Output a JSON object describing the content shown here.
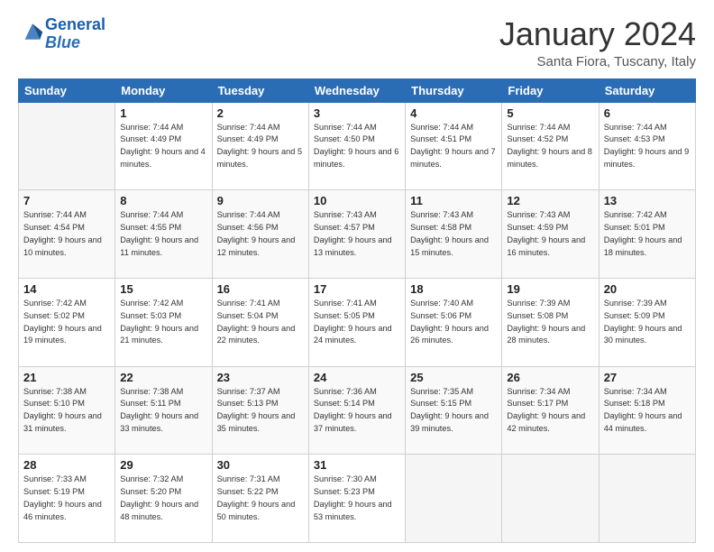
{
  "header": {
    "logo_general": "General",
    "logo_blue": "Blue",
    "month": "January 2024",
    "location": "Santa Fiora, Tuscany, Italy"
  },
  "weekdays": [
    "Sunday",
    "Monday",
    "Tuesday",
    "Wednesday",
    "Thursday",
    "Friday",
    "Saturday"
  ],
  "weeks": [
    [
      {
        "day": "",
        "sunrise": "",
        "sunset": "",
        "daylight": ""
      },
      {
        "day": "1",
        "sunrise": "Sunrise: 7:44 AM",
        "sunset": "Sunset: 4:49 PM",
        "daylight": "Daylight: 9 hours and 4 minutes."
      },
      {
        "day": "2",
        "sunrise": "Sunrise: 7:44 AM",
        "sunset": "Sunset: 4:49 PM",
        "daylight": "Daylight: 9 hours and 5 minutes."
      },
      {
        "day": "3",
        "sunrise": "Sunrise: 7:44 AM",
        "sunset": "Sunset: 4:50 PM",
        "daylight": "Daylight: 9 hours and 6 minutes."
      },
      {
        "day": "4",
        "sunrise": "Sunrise: 7:44 AM",
        "sunset": "Sunset: 4:51 PM",
        "daylight": "Daylight: 9 hours and 7 minutes."
      },
      {
        "day": "5",
        "sunrise": "Sunrise: 7:44 AM",
        "sunset": "Sunset: 4:52 PM",
        "daylight": "Daylight: 9 hours and 8 minutes."
      },
      {
        "day": "6",
        "sunrise": "Sunrise: 7:44 AM",
        "sunset": "Sunset: 4:53 PM",
        "daylight": "Daylight: 9 hours and 9 minutes."
      }
    ],
    [
      {
        "day": "7",
        "sunrise": "Sunrise: 7:44 AM",
        "sunset": "Sunset: 4:54 PM",
        "daylight": "Daylight: 9 hours and 10 minutes."
      },
      {
        "day": "8",
        "sunrise": "Sunrise: 7:44 AM",
        "sunset": "Sunset: 4:55 PM",
        "daylight": "Daylight: 9 hours and 11 minutes."
      },
      {
        "day": "9",
        "sunrise": "Sunrise: 7:44 AM",
        "sunset": "Sunset: 4:56 PM",
        "daylight": "Daylight: 9 hours and 12 minutes."
      },
      {
        "day": "10",
        "sunrise": "Sunrise: 7:43 AM",
        "sunset": "Sunset: 4:57 PM",
        "daylight": "Daylight: 9 hours and 13 minutes."
      },
      {
        "day": "11",
        "sunrise": "Sunrise: 7:43 AM",
        "sunset": "Sunset: 4:58 PM",
        "daylight": "Daylight: 9 hours and 15 minutes."
      },
      {
        "day": "12",
        "sunrise": "Sunrise: 7:43 AM",
        "sunset": "Sunset: 4:59 PM",
        "daylight": "Daylight: 9 hours and 16 minutes."
      },
      {
        "day": "13",
        "sunrise": "Sunrise: 7:42 AM",
        "sunset": "Sunset: 5:01 PM",
        "daylight": "Daylight: 9 hours and 18 minutes."
      }
    ],
    [
      {
        "day": "14",
        "sunrise": "Sunrise: 7:42 AM",
        "sunset": "Sunset: 5:02 PM",
        "daylight": "Daylight: 9 hours and 19 minutes."
      },
      {
        "day": "15",
        "sunrise": "Sunrise: 7:42 AM",
        "sunset": "Sunset: 5:03 PM",
        "daylight": "Daylight: 9 hours and 21 minutes."
      },
      {
        "day": "16",
        "sunrise": "Sunrise: 7:41 AM",
        "sunset": "Sunset: 5:04 PM",
        "daylight": "Daylight: 9 hours and 22 minutes."
      },
      {
        "day": "17",
        "sunrise": "Sunrise: 7:41 AM",
        "sunset": "Sunset: 5:05 PM",
        "daylight": "Daylight: 9 hours and 24 minutes."
      },
      {
        "day": "18",
        "sunrise": "Sunrise: 7:40 AM",
        "sunset": "Sunset: 5:06 PM",
        "daylight": "Daylight: 9 hours and 26 minutes."
      },
      {
        "day": "19",
        "sunrise": "Sunrise: 7:39 AM",
        "sunset": "Sunset: 5:08 PM",
        "daylight": "Daylight: 9 hours and 28 minutes."
      },
      {
        "day": "20",
        "sunrise": "Sunrise: 7:39 AM",
        "sunset": "Sunset: 5:09 PM",
        "daylight": "Daylight: 9 hours and 30 minutes."
      }
    ],
    [
      {
        "day": "21",
        "sunrise": "Sunrise: 7:38 AM",
        "sunset": "Sunset: 5:10 PM",
        "daylight": "Daylight: 9 hours and 31 minutes."
      },
      {
        "day": "22",
        "sunrise": "Sunrise: 7:38 AM",
        "sunset": "Sunset: 5:11 PM",
        "daylight": "Daylight: 9 hours and 33 minutes."
      },
      {
        "day": "23",
        "sunrise": "Sunrise: 7:37 AM",
        "sunset": "Sunset: 5:13 PM",
        "daylight": "Daylight: 9 hours and 35 minutes."
      },
      {
        "day": "24",
        "sunrise": "Sunrise: 7:36 AM",
        "sunset": "Sunset: 5:14 PM",
        "daylight": "Daylight: 9 hours and 37 minutes."
      },
      {
        "day": "25",
        "sunrise": "Sunrise: 7:35 AM",
        "sunset": "Sunset: 5:15 PM",
        "daylight": "Daylight: 9 hours and 39 minutes."
      },
      {
        "day": "26",
        "sunrise": "Sunrise: 7:34 AM",
        "sunset": "Sunset: 5:17 PM",
        "daylight": "Daylight: 9 hours and 42 minutes."
      },
      {
        "day": "27",
        "sunrise": "Sunrise: 7:34 AM",
        "sunset": "Sunset: 5:18 PM",
        "daylight": "Daylight: 9 hours and 44 minutes."
      }
    ],
    [
      {
        "day": "28",
        "sunrise": "Sunrise: 7:33 AM",
        "sunset": "Sunset: 5:19 PM",
        "daylight": "Daylight: 9 hours and 46 minutes."
      },
      {
        "day": "29",
        "sunrise": "Sunrise: 7:32 AM",
        "sunset": "Sunset: 5:20 PM",
        "daylight": "Daylight: 9 hours and 48 minutes."
      },
      {
        "day": "30",
        "sunrise": "Sunrise: 7:31 AM",
        "sunset": "Sunset: 5:22 PM",
        "daylight": "Daylight: 9 hours and 50 minutes."
      },
      {
        "day": "31",
        "sunrise": "Sunrise: 7:30 AM",
        "sunset": "Sunset: 5:23 PM",
        "daylight": "Daylight: 9 hours and 53 minutes."
      },
      {
        "day": "",
        "sunrise": "",
        "sunset": "",
        "daylight": ""
      },
      {
        "day": "",
        "sunrise": "",
        "sunset": "",
        "daylight": ""
      },
      {
        "day": "",
        "sunrise": "",
        "sunset": "",
        "daylight": ""
      }
    ]
  ]
}
